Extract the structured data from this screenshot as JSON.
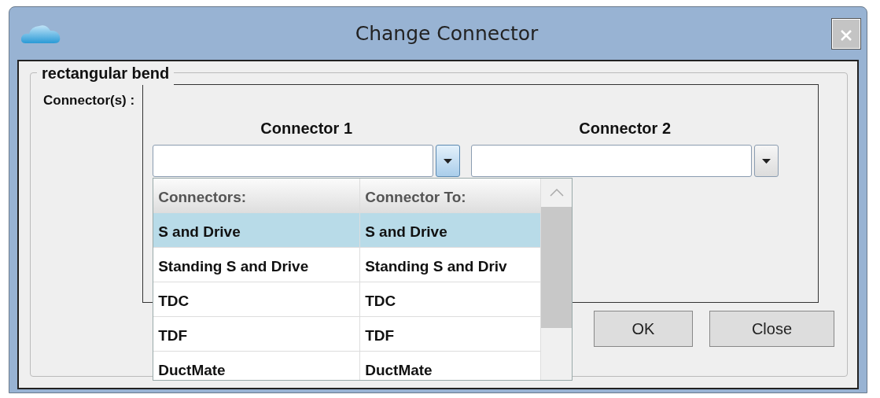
{
  "window": {
    "title": "Change Connector"
  },
  "group": {
    "legend": "rectangular bend",
    "label": "Connector(s) :"
  },
  "connectors": [
    {
      "heading": "Connector 1",
      "expanded": true
    },
    {
      "heading": "Connector 2",
      "expanded": false
    }
  ],
  "dropdown": {
    "columns": [
      "Connectors:",
      "Connector To:"
    ],
    "rows": [
      {
        "cells": [
          "S and Drive",
          "S and Drive"
        ],
        "selected": true
      },
      {
        "cells": [
          "Standing S and Drive",
          "Standing S and Driv"
        ],
        "selected": false
      },
      {
        "cells": [
          "TDC",
          "TDC"
        ],
        "selected": false
      },
      {
        "cells": [
          "TDF",
          "TDF"
        ],
        "selected": false
      },
      {
        "cells": [
          "DuctMate",
          "DuctMate"
        ],
        "selected": false
      }
    ]
  },
  "buttons": [
    {
      "label": "OK"
    },
    {
      "label": "Close"
    }
  ]
}
